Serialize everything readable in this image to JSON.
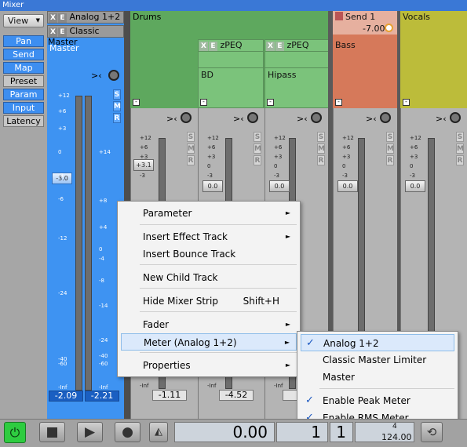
{
  "window": {
    "title": "Mixer"
  },
  "left_panel": {
    "view_label": "View",
    "view_arrow": "▼",
    "buttons": [
      {
        "label": "Pan",
        "on": true
      },
      {
        "label": "Send",
        "on": true
      },
      {
        "label": "Map",
        "on": true
      },
      {
        "label": "Preset",
        "on": false
      },
      {
        "label": "Param",
        "on": true
      },
      {
        "label": "Input",
        "on": true
      },
      {
        "label": "Latency",
        "on": false
      }
    ]
  },
  "master": {
    "fx": [
      {
        "x": "X",
        "e": "E",
        "name": "Analog 1+2"
      },
      {
        "x": "X",
        "e": "E",
        "name": "Classic Master"
      }
    ],
    "name": "Master",
    "pan_label": ">‹",
    "fader_value": "-3.0",
    "values": [
      "-2.09",
      "-2.21"
    ],
    "smr": [
      "S",
      "M",
      "R"
    ],
    "scale_left": [
      "+12",
      "+6",
      "+3",
      "0",
      "-3",
      "-6",
      "-12",
      "-24",
      "-40",
      "-60",
      "-Inf"
    ],
    "scale_right": [
      "+14",
      "+8",
      "+4",
      "0",
      "-4",
      "-8",
      "-14",
      "-24",
      "-40",
      "-60",
      "-Inf"
    ]
  },
  "tracks": [
    {
      "name": "Drums",
      "color": "#5da85d"
    },
    {
      "name": "Send 1",
      "send_value": "-7.00",
      "color": "#d77a5a",
      "sub": "Bass"
    },
    {
      "name": "Vocals",
      "color": "#bdbd3a"
    }
  ],
  "subtracks": [
    {
      "fx_name": "zPEQ",
      "name": "BD",
      "x": "X",
      "e": "E"
    },
    {
      "fx_name": "zPEQ",
      "name": "Hipass",
      "x": "X",
      "e": "E"
    }
  ],
  "strips": [
    {
      "fader": "+3.1",
      "value": "-1.11"
    },
    {
      "fader": "0.0",
      "value": "-4.52"
    },
    {
      "fader": "0.0",
      "value": ""
    },
    {
      "fader": "0.0",
      "value": ""
    },
    {
      "fader": "0.0",
      "value": ""
    }
  ],
  "strip_scale": [
    "+12",
    "+6",
    "+3",
    "0",
    "-3"
  ],
  "strip_bottom": [
    "-Inf"
  ],
  "smr": [
    "S",
    "M",
    "R"
  ],
  "collapse_icon": "-",
  "pan_label": ">‹",
  "context_menu": {
    "items": [
      {
        "label": "Parameter",
        "submenu": true
      },
      {
        "label": "Insert Effect Track",
        "submenu": true
      },
      {
        "label": "Insert Bounce Track",
        "submenu": false
      },
      {
        "label": "New Child Track",
        "submenu": false
      },
      {
        "label": "Hide Mixer Strip",
        "shortcut": "Shift+H",
        "submenu": false
      },
      {
        "label": "Fader",
        "submenu": true
      },
      {
        "label": "Meter (Analog 1+2)",
        "submenu": true,
        "highlighted": true
      },
      {
        "label": "Properties",
        "submenu": true
      }
    ],
    "arrow": "►"
  },
  "submenu": {
    "items": [
      {
        "label": "Analog 1+2",
        "checked": true,
        "highlighted": true
      },
      {
        "label": "Classic Master Limiter",
        "checked": false
      },
      {
        "label": "Master",
        "checked": false
      },
      {
        "label": "Enable Peak Meter",
        "checked": true
      },
      {
        "label": "Enable RMS Meter",
        "checked": true
      }
    ],
    "check": "✓"
  },
  "transport": {
    "power": "⏻",
    "stop": "■",
    "play": "▶",
    "record": "●",
    "metronome": "◭",
    "time": "0.00",
    "bar": "1",
    "beat": "1",
    "tempo": "124.00",
    "tempo_top": "4",
    "loop_icon": "⟲",
    "accent": "#2ecc40"
  }
}
